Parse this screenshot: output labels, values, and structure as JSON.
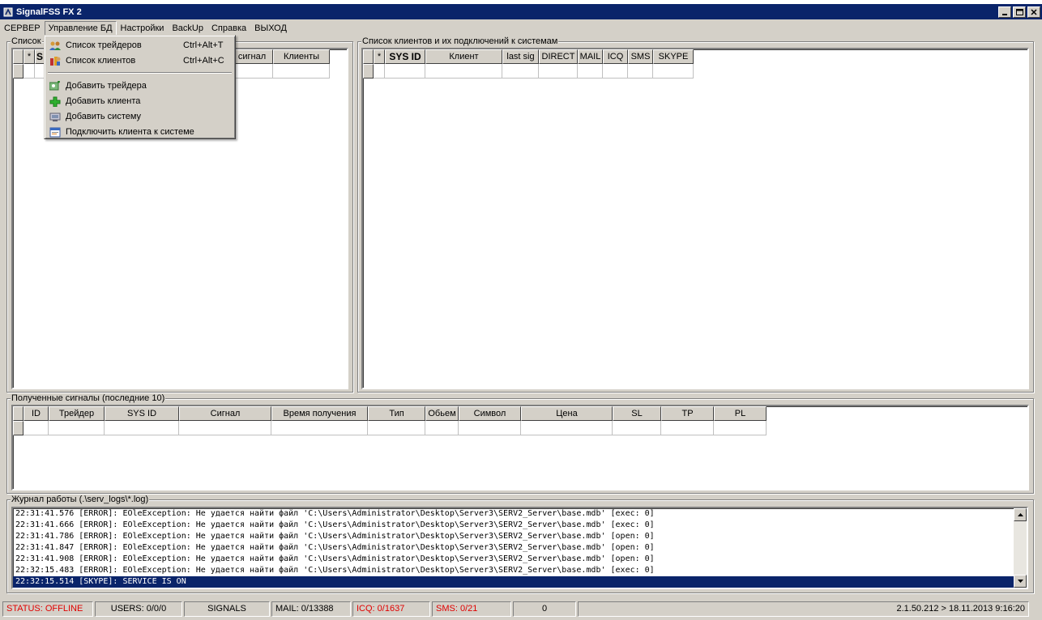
{
  "window": {
    "title": "SignalFSS FX 2"
  },
  "menubar": [
    "СЕРВЕР",
    "Управление БД",
    "Настройки",
    "BackUp",
    "Справка",
    "ВЫХОД"
  ],
  "dropdown": {
    "items": [
      {
        "label": "Список трейдеров",
        "shortcut": "Ctrl+Alt+T",
        "icon": "traders-icon"
      },
      {
        "label": "Список клиентов",
        "shortcut": "Ctrl+Alt+C",
        "icon": "clients-icon"
      },
      {
        "label": "Добавить трейдера",
        "shortcut": "",
        "icon": "add-trader-icon"
      },
      {
        "label": "Добавить клиента",
        "shortcut": "",
        "icon": "add-client-icon"
      },
      {
        "label": "Добавить систему",
        "shortcut": "",
        "icon": "add-system-icon"
      },
      {
        "label": "Подключить клиента к системе",
        "shortcut": "",
        "icon": "connect-client-icon"
      }
    ]
  },
  "left_panel": {
    "legend": "Список",
    "columns": [
      "*",
      "S",
      "сигнал",
      "Клиенты"
    ]
  },
  "clients_panel": {
    "legend": "Список клиентов и их подключений к системам",
    "columns": [
      "*",
      "SYS ID",
      "Клиент",
      "last sig",
      "DIRECT",
      "MAIL",
      "ICQ",
      "SMS",
      "SKYPE"
    ]
  },
  "signals_panel": {
    "legend": "Полученные сигналы (последние 10)",
    "columns": [
      "ID",
      "Трейдер",
      "SYS ID",
      "Сигнал",
      "Время получения",
      "Тип",
      "Обьем",
      "Символ",
      "Цена",
      "SL",
      "TP",
      "PL"
    ]
  },
  "log_panel": {
    "legend": "Журнал работы (.\\serv_logs\\*.log)",
    "lines": [
      "22:31:41.576 [ERROR]: EOleException: Не удается найти файл 'C:\\Users\\Administrator\\Desktop\\Server3\\SERV2_Server\\base.mdb' [exec: 0]",
      "22:31:41.666 [ERROR]: EOleException: Не удается найти файл 'C:\\Users\\Administrator\\Desktop\\Server3\\SERV2_Server\\base.mdb' [exec: 0]",
      "22:31:41.786 [ERROR]: EOleException: Не удается найти файл 'C:\\Users\\Administrator\\Desktop\\Server3\\SERV2_Server\\base.mdb' [open: 0]",
      "22:31:41.847 [ERROR]: EOleException: Не удается найти файл 'C:\\Users\\Administrator\\Desktop\\Server3\\SERV2_Server\\base.mdb' [open: 0]",
      "22:31:41.908 [ERROR]: EOleException: Не удается найти файл 'C:\\Users\\Administrator\\Desktop\\Server3\\SERV2_Server\\base.mdb' [open: 0]",
      "22:32:15.483 [ERROR]: EOleException: Не удается найти файл 'C:\\Users\\Administrator\\Desktop\\Server3\\SERV2_Server\\base.mdb' [exec: 0]",
      "22:32:15.514 [SKYPE]: SERVICE IS ON"
    ]
  },
  "statusbar": {
    "status": "STATUS: OFFLINE",
    "users": "USERS: 0/0/0",
    "signals": "SIGNALS",
    "mail": "MAIL: 0/13388",
    "icq": "ICQ: 0/1637",
    "sms": "SMS: 0/21",
    "count": "0",
    "version": "2.1.50.212 > 18.11.2013 9:16:20"
  },
  "colors": {
    "titlebar": "#0a246a",
    "face": "#d4d0c8",
    "error_text": "#e00000",
    "selection": "#0a246a"
  }
}
